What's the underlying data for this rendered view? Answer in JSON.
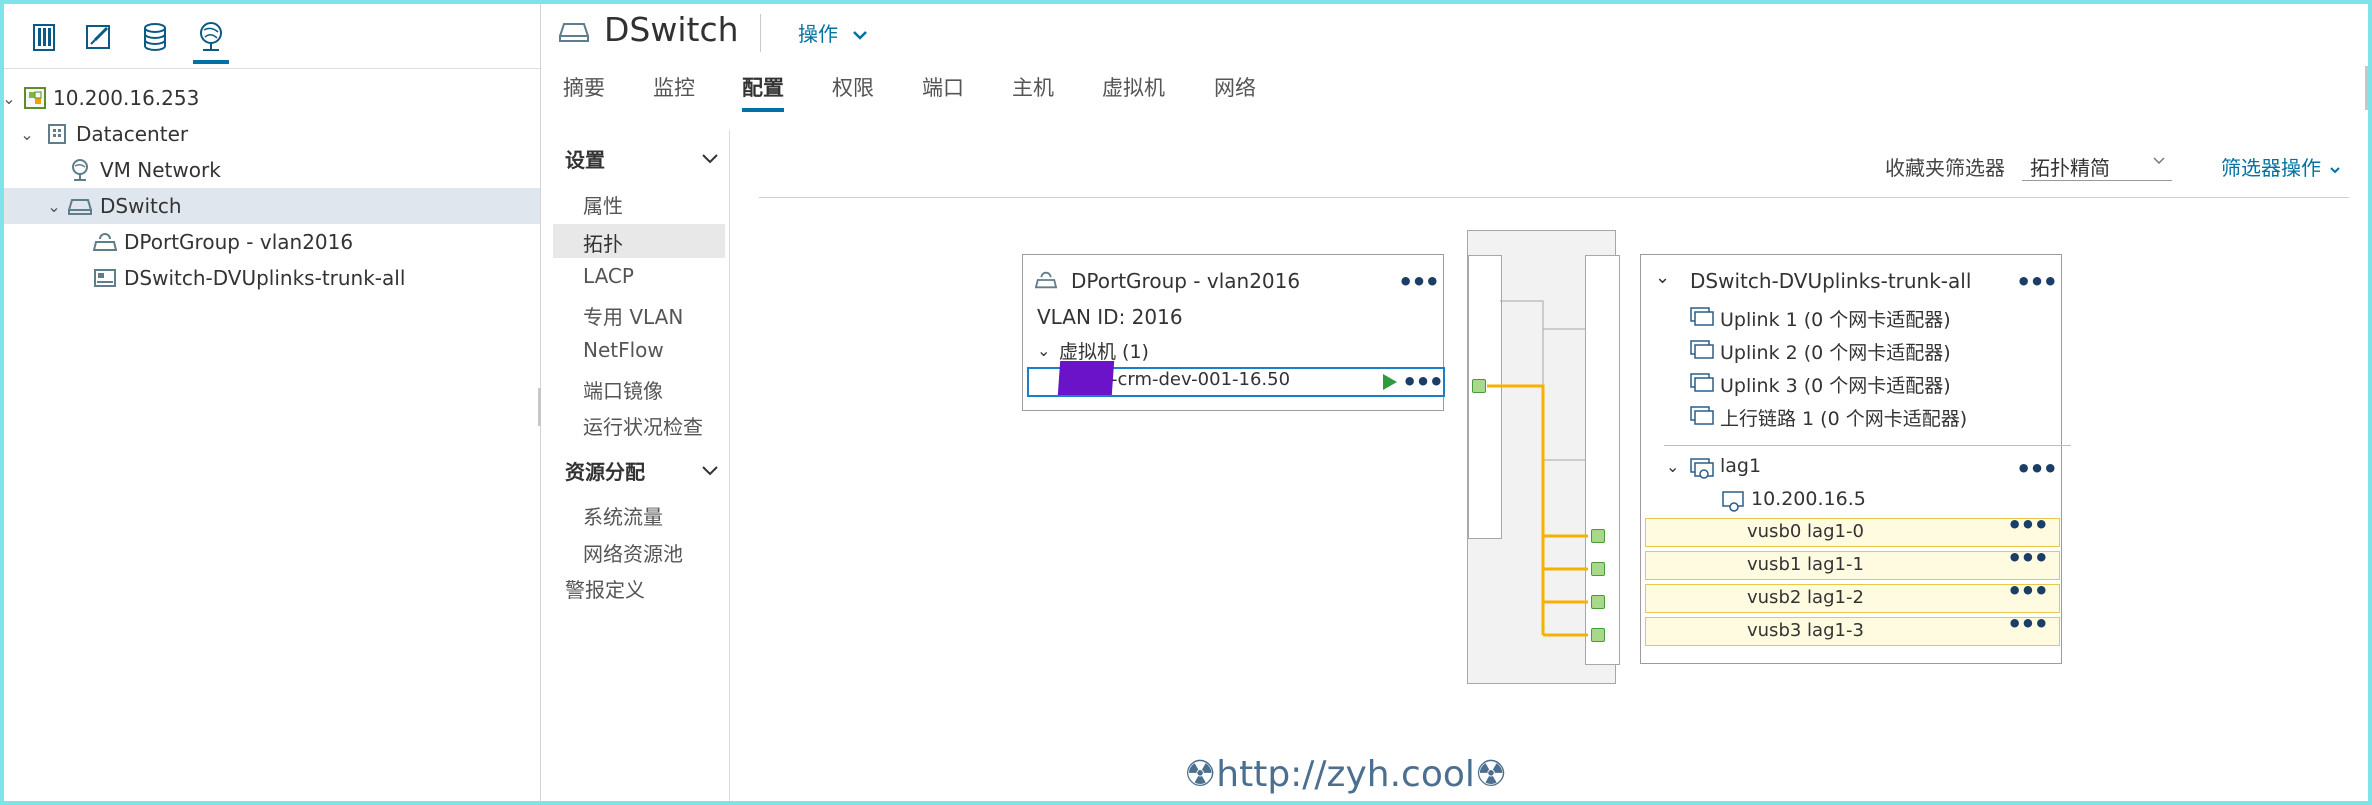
{
  "left_icons": [
    "hosts-clusters-icon",
    "vms-templates-icon",
    "storage-icon",
    "networking-icon"
  ],
  "tree": {
    "items": [
      {
        "label": "10.200.16.253",
        "icon": "vcenter-icon",
        "expanded": true
      },
      {
        "label": "Datacenter",
        "icon": "datacenter-icon",
        "expanded": true
      },
      {
        "label": "VM Network",
        "icon": "network-icon"
      },
      {
        "label": "DSwitch",
        "icon": "dswitch-icon",
        "expanded": true,
        "selected": true
      },
      {
        "label": "DPortGroup - vlan2016",
        "icon": "portgroup-icon"
      },
      {
        "label": "DSwitch-DVUplinks-trunk-all",
        "icon": "uplink-portgroup-icon"
      }
    ]
  },
  "header": {
    "title": "DSwitch",
    "actions_label": "操作"
  },
  "tabs": [
    "摘要",
    "监控",
    "配置",
    "权限",
    "端口",
    "主机",
    "虚拟机",
    "网络"
  ],
  "active_tab": "配置",
  "side_nav": {
    "settings_title": "设置",
    "settings_items": [
      "属性",
      "拓扑",
      "LACP",
      "专用 VLAN",
      "NetFlow",
      "端口镜像",
      "运行状况检查"
    ],
    "active_item": "拓扑",
    "resource_title": "资源分配",
    "resource_items": [
      "系统流量",
      "网络资源池"
    ],
    "alarm_label": "警报定义"
  },
  "filters": {
    "label": "收藏夹筛选器",
    "selected": "拓扑精简",
    "actions_label": "筛选器操作"
  },
  "portgroup_card": {
    "title": "DPortGroup - vlan2016",
    "vlan": "VLAN ID: 2016",
    "vm_group": "虚拟机 (1)",
    "vm_name": "-crm-dev-001-16.50"
  },
  "uplink_card": {
    "title": "DSwitch-DVUplinks-trunk-all",
    "uplinks": [
      "Uplink 1 (0 个网卡适配器)",
      "Uplink 2 (0 个网卡适配器)",
      "Uplink 3 (0 个网卡适配器)",
      "上行链路 1 (0 个网卡适配器)"
    ],
    "lag_name": "lag1",
    "lag_host": "10.200.16.5",
    "lag_ports": [
      "vusb0 lag1-0",
      "vusb1 lag1-1",
      "vusb2 lag1-2",
      "vusb3 lag1-3"
    ]
  },
  "watermark": "☢http://zyh.cool☢",
  "colors": {
    "accent": "#0072a3",
    "connection": "#f5b200",
    "selection": "#dfe6ed",
    "border": "#7fe3ea"
  }
}
